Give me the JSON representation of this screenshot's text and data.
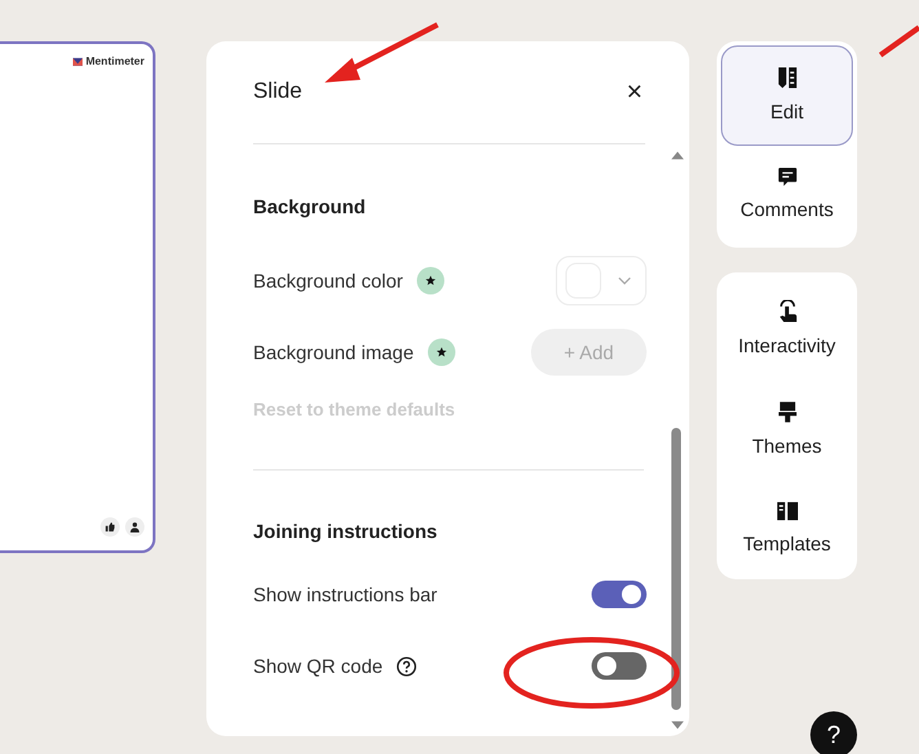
{
  "slide_preview": {
    "logo": "Mentimeter"
  },
  "panel": {
    "title": "Slide",
    "close": "×",
    "sections": [
      {
        "heading": "Background",
        "rows": [
          {
            "kind": "color",
            "label": "Background color"
          },
          {
            "kind": "button",
            "label": "Background image",
            "button": "+ Add"
          }
        ],
        "link": "Reset to theme defaults"
      },
      {
        "heading": "Joining instructions",
        "rows": [
          {
            "kind": "toggle",
            "label": "Show instructions bar",
            "on": true,
            "help": false
          },
          {
            "kind": "toggle",
            "label": "Show QR code",
            "on": false,
            "help": true
          }
        ]
      }
    ]
  },
  "rail": [
    {
      "label": "Edit",
      "selected": true
    },
    {
      "label": "Comments",
      "selected": false
    },
    {
      "label": "Interactivity",
      "selected": false
    },
    {
      "label": "Themes",
      "selected": false
    },
    {
      "label": "Templates",
      "selected": false
    }
  ],
  "help_button": "?"
}
